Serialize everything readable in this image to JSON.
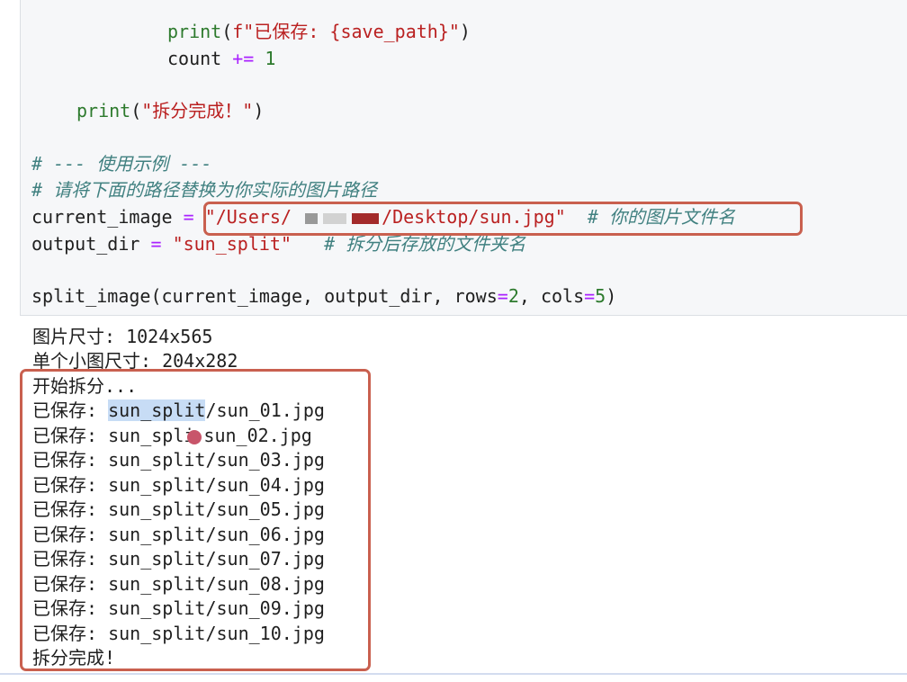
{
  "code": {
    "line1": {
      "fn": "print",
      "open": "(",
      "str": "f\"已保存: {save_path}\"",
      "close": ")"
    },
    "line2": {
      "var": "count",
      "op": "+=",
      "num": "1"
    },
    "line3": {
      "fn": "print",
      "open": "(",
      "str": "\"拆分完成！\"",
      "close": ")"
    },
    "comment1": "# --- 使用示例 ---",
    "comment2": "# 请将下面的路径替换为你实际的图片路径",
    "line_current": {
      "var": "current_image",
      "op": "=",
      "str_a": "\"/Users/",
      "str_b": "/Desktop/sun.jpg\"",
      "comment": "# 你的图片文件名"
    },
    "line_output": {
      "var": "output_dir",
      "op": "=",
      "str": "\"sun_split\"",
      "comment": "# 拆分后存放的文件夹名"
    },
    "line_call": {
      "fn": "split_image(current_image, output_dir, rows",
      "op1": "=",
      "n1": "2",
      "mid": ", cols",
      "op2": "=",
      "n2": "5",
      "close": ")"
    }
  },
  "output": {
    "size": "图片尺寸: 1024x565",
    "tile_size": "单个小图尺寸: 204x282",
    "start": "开始拆分...",
    "saved_prefix": "已保存: ",
    "first_sel": "sun_split",
    "first_rest": "/sun_01.jpg",
    "second_a": "sun_spli",
    "second_b": "sun_02.jpg",
    "files": [
      "sun_split/sun_03.jpg",
      "sun_split/sun_04.jpg",
      "sun_split/sun_05.jpg",
      "sun_split/sun_06.jpg",
      "sun_split/sun_07.jpg",
      "sun_split/sun_08.jpg",
      "sun_split/sun_09.jpg",
      "sun_split/sun_10.jpg"
    ],
    "done": "拆分完成!"
  },
  "colors": {
    "highlight_box": "#c9604f",
    "cursor_dot": "#c8556a",
    "selection": "#c7dcf5"
  }
}
